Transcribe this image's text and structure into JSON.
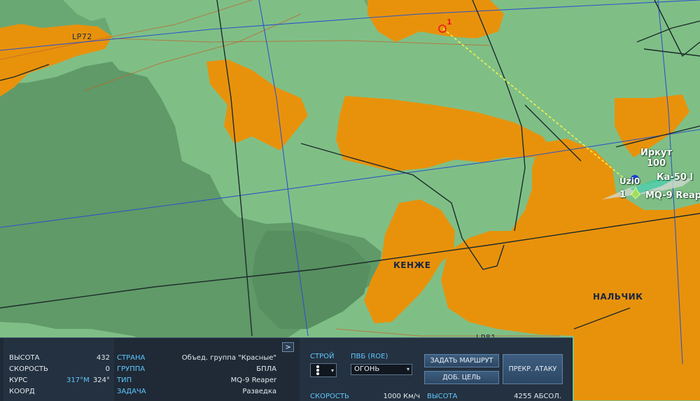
{
  "map": {
    "labels": {
      "lp72": "LP72",
      "lp81": "LP81",
      "kenzhe": "КЕНЖЕ",
      "nalchik": "НАЛЬЧИК"
    },
    "waypoint_number": "1",
    "units": {
      "irkut": "Иркут",
      "irkut_number": "100",
      "label_mid": "Uzi0",
      "label_cut": "Ка-50 I",
      "label_mq9": "MQ-9 Reap",
      "label_one": "1"
    },
    "colors": {
      "land_light": "#7fbf86",
      "land_dark": "#5f9a68",
      "urban": "#e8920c",
      "route": "#f4f24a",
      "waypoint": "#e81919"
    }
  },
  "panel": {
    "info": {
      "altitude_label": "ВЫСОТА",
      "altitude_value": "432",
      "speed_label": "СКОРОСТЬ",
      "speed_value": "0",
      "course_label": "КУРС",
      "course_magnetic": "317°M",
      "course_true": "324°",
      "coord_label": "КООРД"
    },
    "details": {
      "country_label": "СТРАНА",
      "country_value": "Объед. группа \"Красные\"",
      "group_label": "ГРУППА",
      "group_value": "БПЛА",
      "type_label": "ТИП",
      "type_value": "MQ-9 Reaper",
      "task_label": "ЗАДАЧА",
      "task_value": "Разведка"
    },
    "collapse_symbol": ">",
    "controls": {
      "formation_label": "СТРОЙ",
      "roe_label": "ПВБ (ROE)",
      "roe_value": "ОГОНЬ",
      "set_route_button": "ЗАДАТЬ МАРШРУТ",
      "add_target_button": "ДОБ. ЦЕЛЬ",
      "stop_attack_button": "ПРЕКР. АТАКУ",
      "speed_label": "СКОРОСТЬ",
      "speed_value": "1000 Км/ч",
      "altitude_label": "ВЫСОТА",
      "altitude_value": "4255 АБСОЛ."
    }
  }
}
